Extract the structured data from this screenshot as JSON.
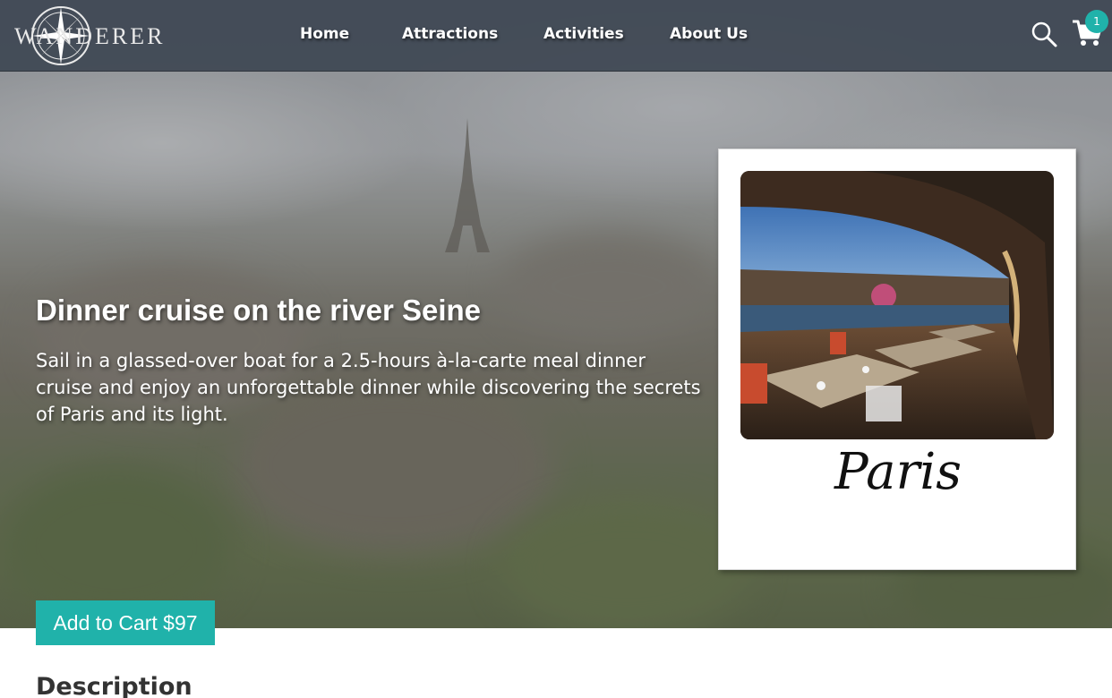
{
  "brand": {
    "logo_text": "WANDERER"
  },
  "nav": {
    "items": [
      {
        "label": "Home"
      },
      {
        "label": "Attractions"
      },
      {
        "label": "Activities"
      },
      {
        "label": "About Us"
      }
    ]
  },
  "header_icons": {
    "search": "search-icon",
    "cart": "cart-icon",
    "cart_count": "1"
  },
  "hero": {
    "title": "Dinner cruise on the river Seine",
    "description": "Sail in a glassed-over boat for a 2.5-hours à-la-carte meal dinner cruise and enjoy an unforgettable dinner while discovering the secrets of Paris and its light."
  },
  "card": {
    "city": "Paris"
  },
  "cta": {
    "label": "Add to Cart $97"
  },
  "content": {
    "section_heading": "Description"
  },
  "colors": {
    "accent": "#20b2aa",
    "navbar": "#3e4652"
  }
}
